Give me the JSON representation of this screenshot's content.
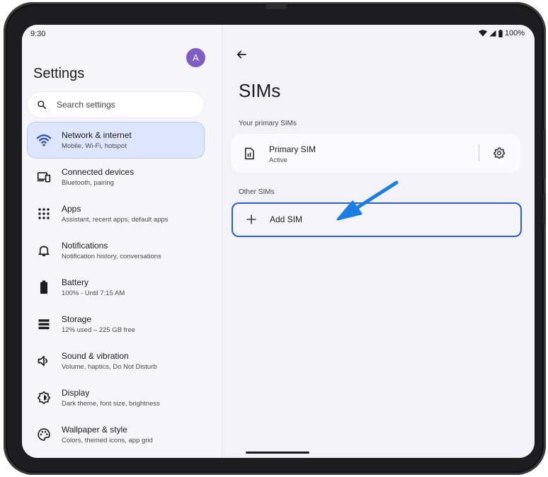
{
  "status": {
    "time": "9:30",
    "battery": "100%"
  },
  "left": {
    "avatar_letter": "A",
    "title": "Settings",
    "search_placeholder": "Search settings",
    "items": [
      {
        "title": "Network & internet",
        "subtitle": "Mobile, Wi-Fi, hotspot",
        "icon": "wifi-icon",
        "active": true
      },
      {
        "title": "Connected devices",
        "subtitle": "Bluetooth, pairing",
        "icon": "devices-icon"
      },
      {
        "title": "Apps",
        "subtitle": "Assistant, recent apps, default apps",
        "icon": "apps-grid-icon"
      },
      {
        "title": "Notifications",
        "subtitle": "Notification history, conversations",
        "icon": "bell-icon"
      },
      {
        "title": "Battery",
        "subtitle": "100% - Until 7:15 AM",
        "icon": "battery-icon"
      },
      {
        "title": "Storage",
        "subtitle": "12% used – 225 GB free",
        "icon": "storage-icon"
      },
      {
        "title": "Sound & vibration",
        "subtitle": "Volume, haptics, Do Not Disturb",
        "icon": "speaker-icon"
      },
      {
        "title": "Display",
        "subtitle": "Dark theme, font size, brightness",
        "icon": "display-icon"
      },
      {
        "title": "Wallpaper & style",
        "subtitle": "Colors, themed icons, app grid",
        "icon": "palette-icon"
      }
    ]
  },
  "right": {
    "title": "SIMs",
    "primary_label": "Your primary SIMs",
    "primary_sim": {
      "title": "Primary SIM",
      "status": "Active"
    },
    "other_label": "Other SIMs",
    "add_sim_label": "Add SIM"
  },
  "colors": {
    "accent": "#2c5fc7",
    "annotation_arrow": "#1a7fe0",
    "active_nav_bg": "#dde6fc"
  }
}
